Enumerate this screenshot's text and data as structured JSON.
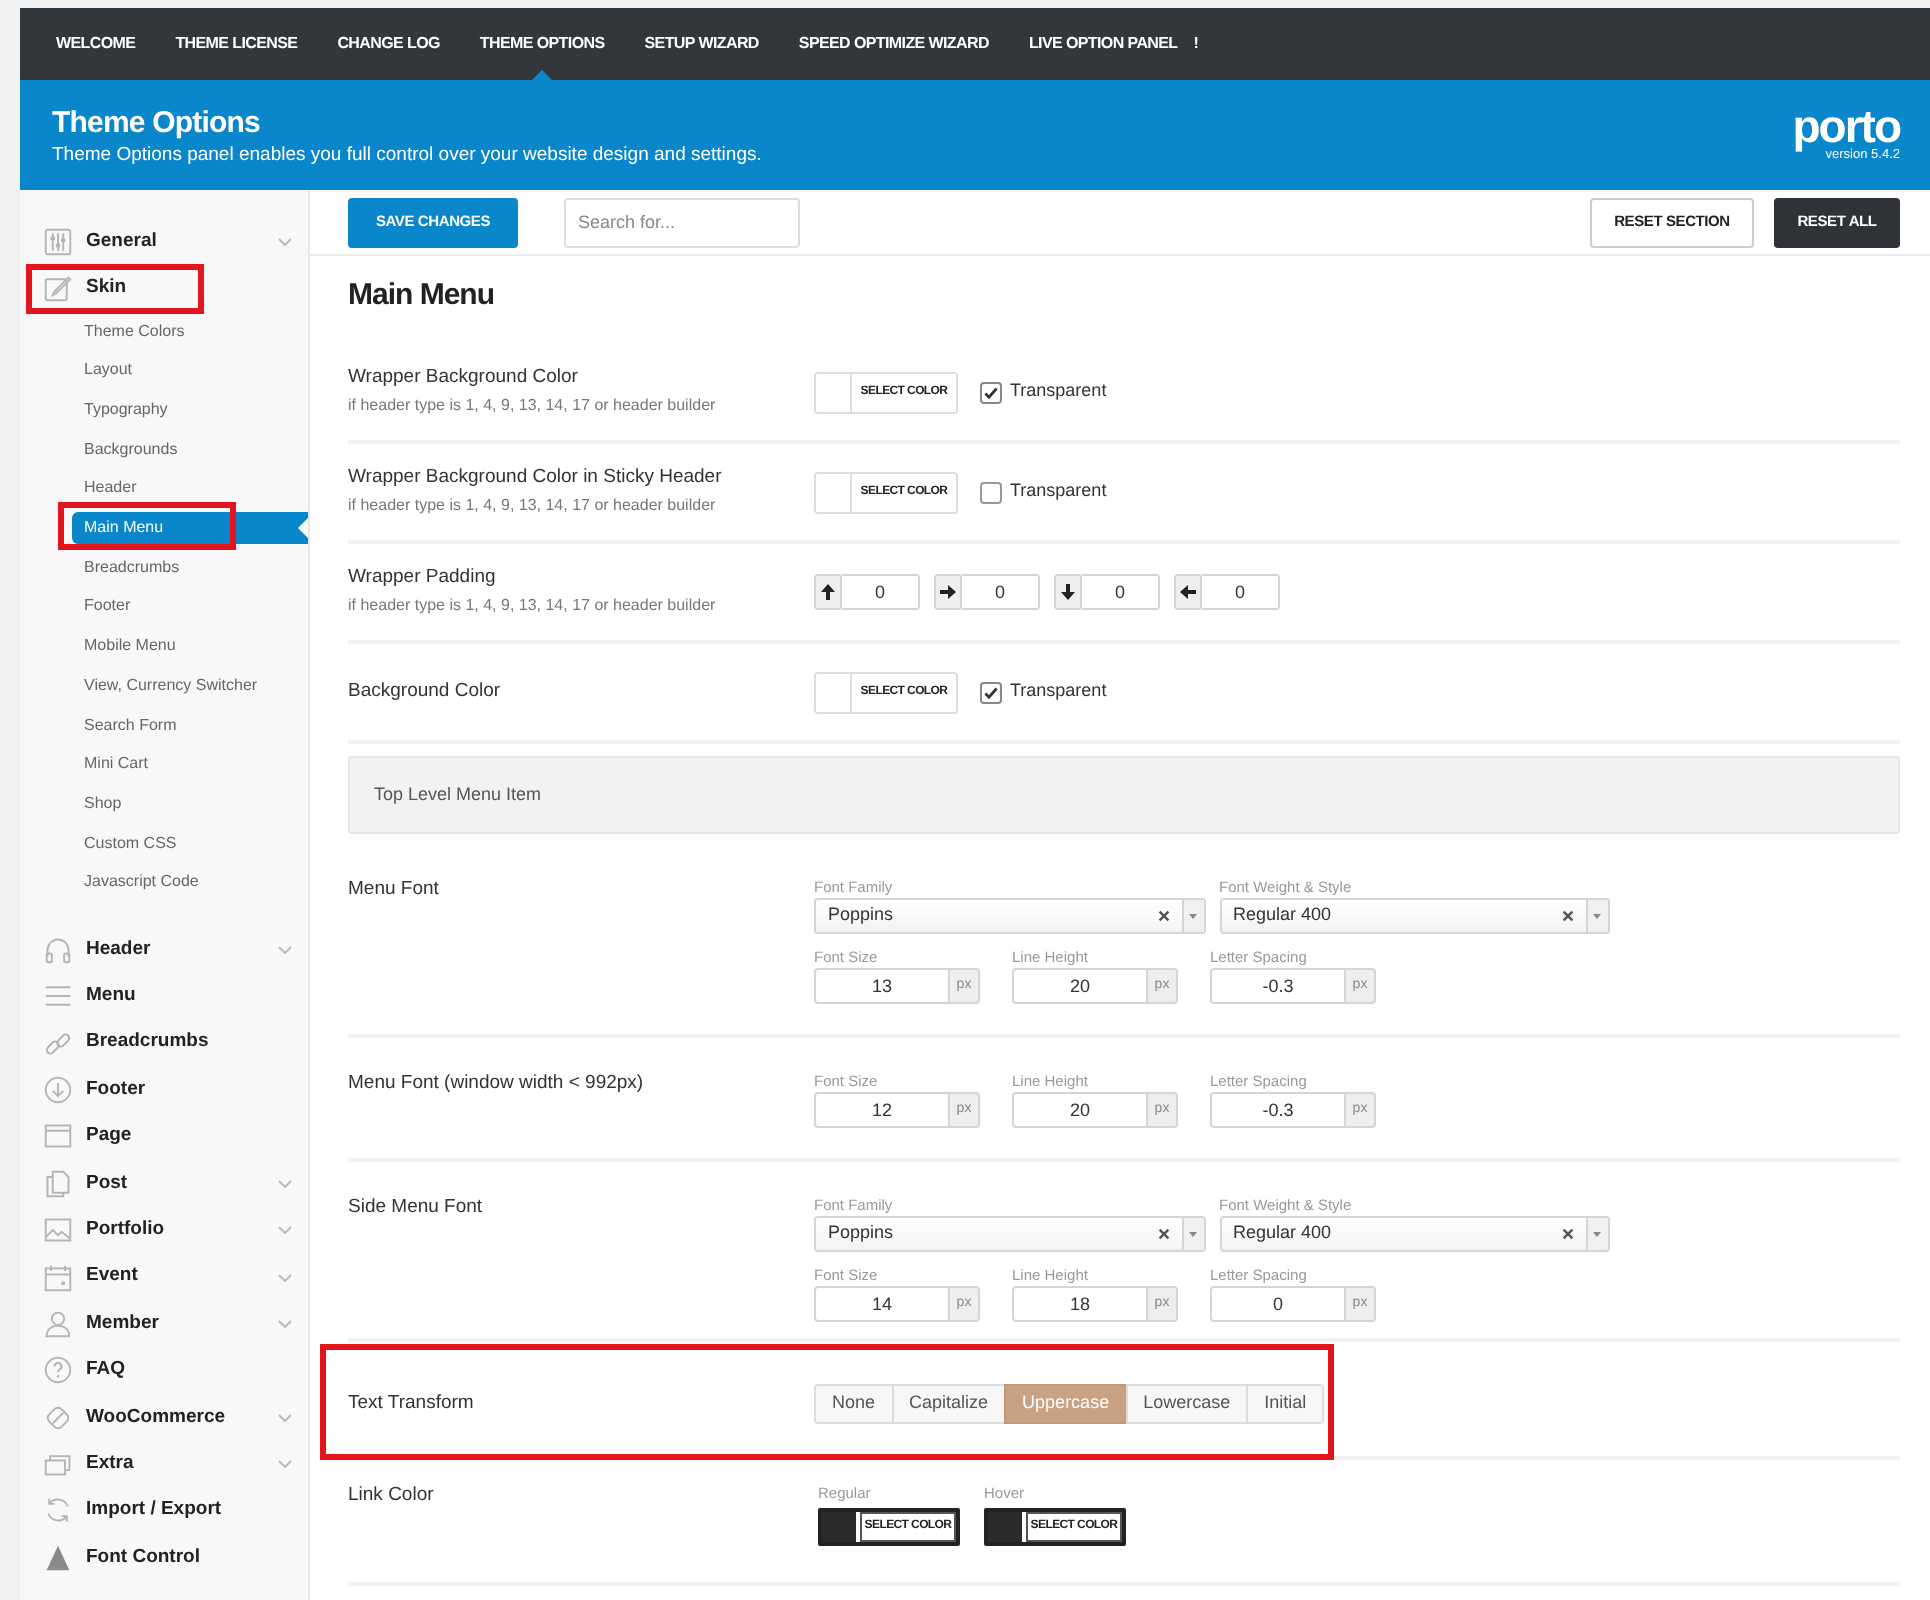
{
  "tabs": [
    {
      "label": "WELCOME",
      "selected": false
    },
    {
      "label": "THEME LICENSE",
      "selected": false
    },
    {
      "label": "CHANGE LOG",
      "selected": false
    },
    {
      "label": "THEME OPTIONS",
      "selected": true
    },
    {
      "label": "SETUP WIZARD",
      "selected": false
    },
    {
      "label": "SPEED OPTIMIZE WIZARD",
      "selected": false
    },
    {
      "label": "LIVE OPTION PANEL",
      "selected": false,
      "badge": "!"
    }
  ],
  "header": {
    "title": "Theme Options",
    "subtitle": "Theme Options panel enables you full control over your website design and settings.",
    "logo": "porto",
    "version": "version 5.4.2"
  },
  "toolbar": {
    "save": "SAVE CHANGES",
    "search": {
      "placeholder": "Search for..."
    },
    "reset_section": "RESET SECTION",
    "reset_all": "RESET ALL"
  },
  "sidebar": {
    "items": [
      {
        "label": "General",
        "collapsible": true,
        "highlighted": false
      },
      {
        "label": "Skin",
        "collapsible": false,
        "highlighted": true,
        "children": [
          {
            "label": "Theme Colors",
            "selected": false,
            "highlighted": false
          },
          {
            "label": "Layout",
            "selected": false,
            "highlighted": false
          },
          {
            "label": "Typography",
            "selected": false,
            "highlighted": false
          },
          {
            "label": "Backgrounds",
            "selected": false,
            "highlighted": false
          },
          {
            "label": "Header",
            "selected": false,
            "highlighted": false
          },
          {
            "label": "Main Menu",
            "selected": true,
            "highlighted": true
          },
          {
            "label": "Breadcrumbs",
            "selected": false,
            "highlighted": false
          },
          {
            "label": "Footer",
            "selected": false,
            "highlighted": false
          },
          {
            "label": "Mobile Menu",
            "selected": false,
            "highlighted": false
          },
          {
            "label": "View, Currency Switcher",
            "selected": false,
            "highlighted": false
          },
          {
            "label": "Search Form",
            "selected": false,
            "highlighted": false
          },
          {
            "label": "Mini Cart",
            "selected": false,
            "highlighted": false
          },
          {
            "label": "Shop",
            "selected": false,
            "highlighted": false
          },
          {
            "label": "Custom CSS",
            "selected": false,
            "highlighted": false
          },
          {
            "label": "Javascript Code",
            "selected": false,
            "highlighted": false
          }
        ]
      },
      {
        "label": "Header",
        "collapsible": true,
        "highlighted": false
      },
      {
        "label": "Menu",
        "collapsible": false,
        "highlighted": false
      },
      {
        "label": "Breadcrumbs",
        "collapsible": false,
        "highlighted": false
      },
      {
        "label": "Footer",
        "collapsible": false,
        "highlighted": false
      },
      {
        "label": "Page",
        "collapsible": false,
        "highlighted": false
      },
      {
        "label": "Post",
        "collapsible": true,
        "highlighted": false
      },
      {
        "label": "Portfolio",
        "collapsible": true,
        "highlighted": false
      },
      {
        "label": "Event",
        "collapsible": true,
        "highlighted": false
      },
      {
        "label": "Member",
        "collapsible": true,
        "highlighted": false
      },
      {
        "label": "FAQ",
        "collapsible": false,
        "highlighted": false
      },
      {
        "label": "WooCommerce",
        "collapsible": true,
        "highlighted": false
      },
      {
        "label": "Extra",
        "collapsible": true,
        "highlighted": false
      },
      {
        "label": "Import / Export",
        "collapsible": false,
        "highlighted": false
      },
      {
        "label": "Font Control",
        "collapsible": false,
        "highlighted": false
      }
    ]
  },
  "content": {
    "title": "Main Menu",
    "sections": [
      {
        "kind": "color",
        "label": "Wrapper Background Color",
        "description": "if header type is 1, 4, 9, 13, 14, 17 or header builder",
        "picker": {
          "button": "SELECT COLOR",
          "color": "#ffffff"
        },
        "transparent": {
          "label": "Transparent",
          "checked": true
        },
        "highlighted": false
      },
      {
        "kind": "color",
        "label": "Wrapper Background Color in Sticky Header",
        "description": "if header type is 1, 4, 9, 13, 14, 17 or header builder",
        "picker": {
          "button": "SELECT COLOR",
          "color": "#ffffff"
        },
        "transparent": {
          "label": "Transparent",
          "checked": false
        },
        "highlighted": false
      },
      {
        "kind": "padding",
        "label": "Wrapper Padding",
        "description": "if header type is 1, 4, 9, 13, 14, 17 or header builder",
        "fields": [
          {
            "value": "0"
          },
          {
            "value": "0"
          },
          {
            "value": "0"
          },
          {
            "value": "0"
          }
        ],
        "highlighted": false
      },
      {
        "kind": "color",
        "label": "Background Color",
        "picker": {
          "button": "SELECT COLOR",
          "color": "#ffffff"
        },
        "transparent": {
          "label": "Transparent",
          "checked": true
        },
        "highlighted": false
      },
      {
        "kind": "heading",
        "label": "Top Level Menu Item",
        "highlighted": false
      },
      {
        "kind": "typography",
        "label": "Menu Font",
        "family": {
          "label": "Font Family",
          "value": "Poppins"
        },
        "weight": {
          "label": "Font Weight & Style",
          "value": "Regular 400"
        },
        "metrics": [
          {
            "label": "Font Size",
            "value": "13",
            "unit": "px"
          },
          {
            "label": "Line Height",
            "value": "20",
            "unit": "px"
          },
          {
            "label": "Letter Spacing",
            "value": "-0.3",
            "unit": "px"
          }
        ],
        "highlighted": false
      },
      {
        "kind": "typography",
        "label": "Menu Font (window width < 992px)",
        "metrics": [
          {
            "label": "Font Size",
            "value": "12",
            "unit": "px"
          },
          {
            "label": "Line Height",
            "value": "20",
            "unit": "px"
          },
          {
            "label": "Letter Spacing",
            "value": "-0.3",
            "unit": "px"
          }
        ],
        "highlighted": false
      },
      {
        "kind": "typography",
        "label": "Side Menu Font",
        "family": {
          "label": "Font Family",
          "value": "Poppins"
        },
        "weight": {
          "label": "Font Weight & Style",
          "value": "Regular 400"
        },
        "metrics": [
          {
            "label": "Font Size",
            "value": "14",
            "unit": "px"
          },
          {
            "label": "Line Height",
            "value": "18",
            "unit": "px"
          },
          {
            "label": "Letter Spacing",
            "value": "0",
            "unit": "px"
          }
        ],
        "highlighted": false
      },
      {
        "kind": "button_set",
        "label": "Text Transform",
        "options": [
          {
            "label": "None",
            "selected": false
          },
          {
            "label": "Capitalize",
            "selected": false
          },
          {
            "label": "Uppercase",
            "selected": true
          },
          {
            "label": "Lowercase",
            "selected": false
          },
          {
            "label": "Initial",
            "selected": false
          }
        ],
        "highlighted": true
      },
      {
        "kind": "link_color",
        "label": "Link Color",
        "pickers": [
          {
            "label": "Regular",
            "button": "SELECT COLOR",
            "color": "#2b2b2b"
          },
          {
            "label": "Hover",
            "button": "SELECT COLOR",
            "color": "#2b2b2b"
          }
        ],
        "highlighted": false
      }
    ]
  }
}
